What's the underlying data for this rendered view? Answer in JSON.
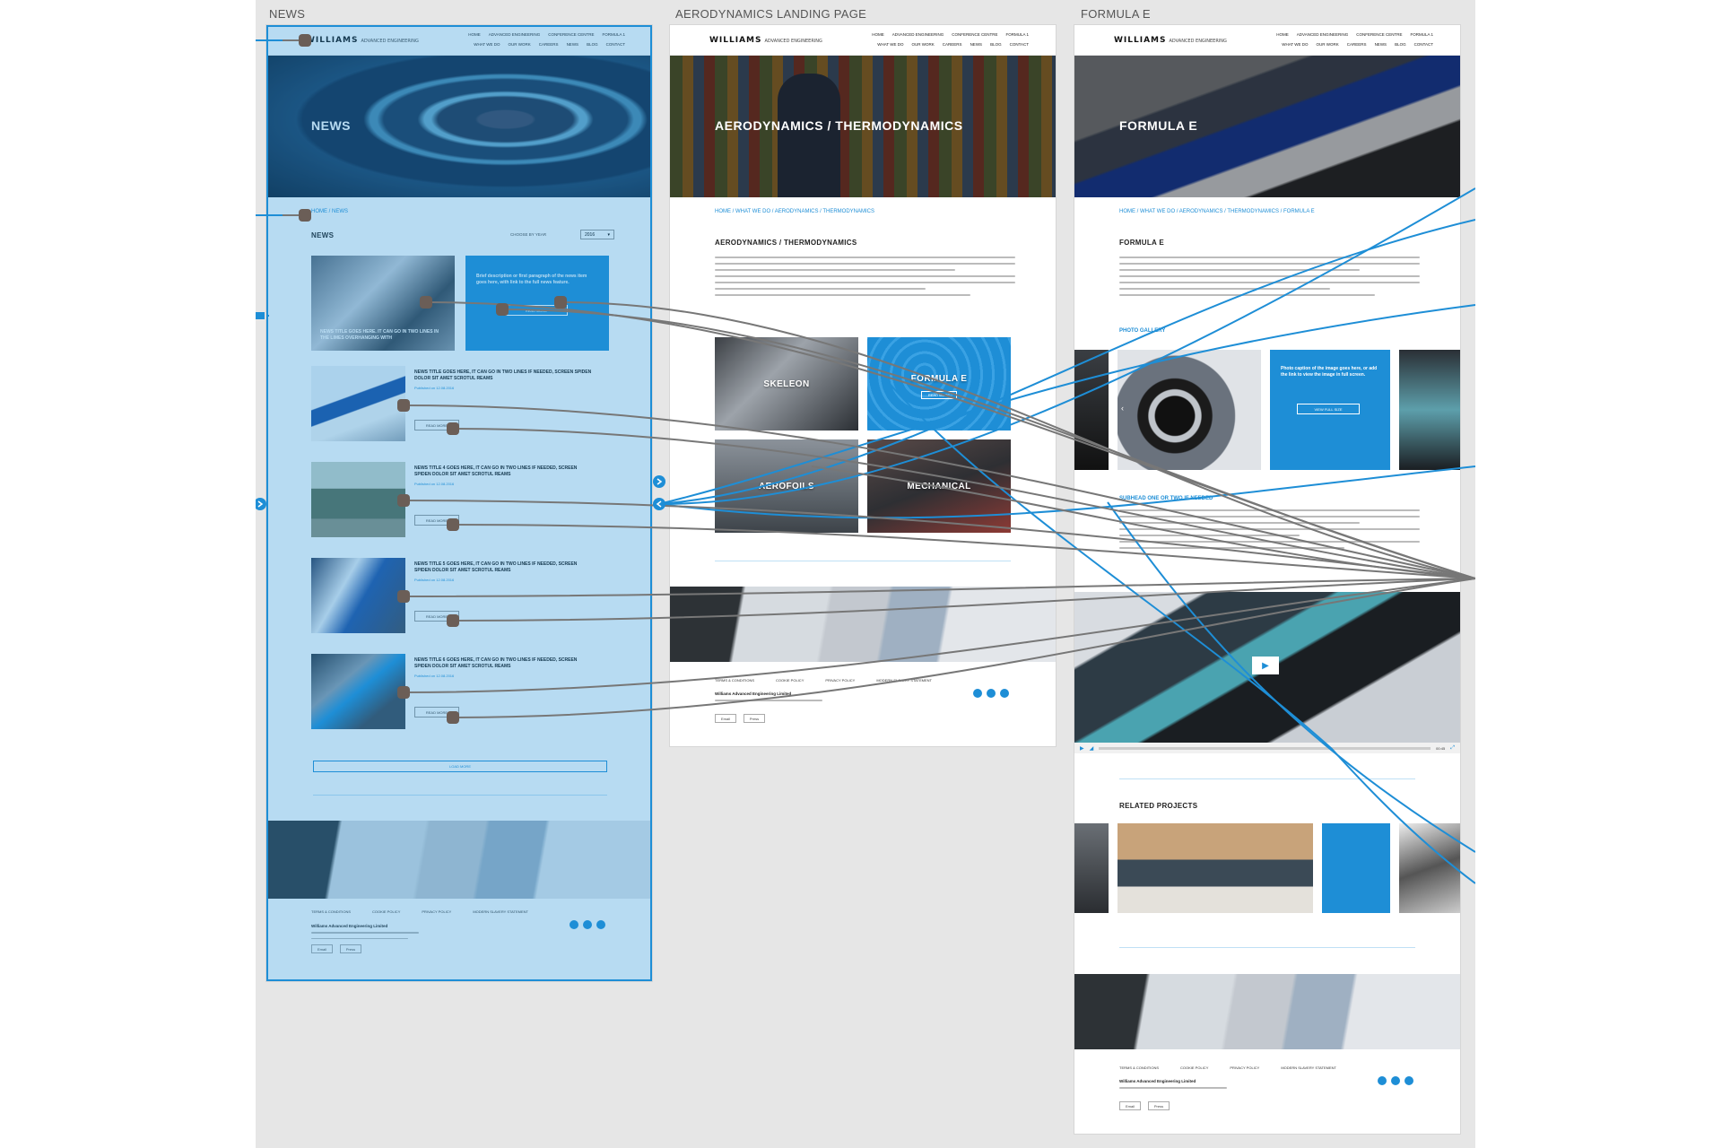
{
  "artboards": {
    "news": {
      "label": "NEWS",
      "brand": "WILLIAMS",
      "brand_sub": "ADVANCED ENGINEERING",
      "nav_top": [
        "Home",
        "Advanced Engineering",
        "Conference Centre",
        "Formula 1"
      ],
      "nav_bottom": [
        "What we do",
        "Our work",
        "Careers",
        "News",
        "Blog",
        "Contact"
      ],
      "hero_title": "NEWS",
      "breadcrumb": "HOME  /  NEWS",
      "section_title": "NEWS",
      "filter_label": "CHOOSE BY YEAR",
      "filter_value": "2016",
      "featured_caption": "NEWS TITLE GOES HERE. IT CAN GO IN TWO LINES IN THE LIMES OVERHANGING WITH",
      "featured_text": "Brief description or first paragraph of the news item goes here, with link to the full news feature.",
      "featured_button": "READ MORE",
      "news_items": [
        {
          "title": "NEWS TITLE GOES HERE, IT CAN GO IN TWO LINES IF NEEDED, SCREEN SPIDEN DOLOR SIT AMET SCROTUL REAMS",
          "date": "Published on 12.08.2016",
          "button": "READ MORE"
        },
        {
          "title": "NEWS TITLE 4 GOES HERE, IT CAN GO IN TWO LINES IF NEEDED, SCREEN SPIDEN DOLOR SIT AMET SCROTUL REAMS",
          "date": "Published on 12.08.2016",
          "button": "READ MORE"
        },
        {
          "title": "NEWS TITLE 5 GOES HERE, IT CAN GO IN TWO LINES IF NEEDED, SCREEN SPIDEN DOLOR SIT AMET SCROTUL REAMS",
          "date": "Published on 12.08.2016",
          "button": "READ MORE"
        },
        {
          "title": "NEWS TITLE 6 GOES HERE, IT CAN GO IN TWO LINES IF NEEDED, SCREEN SPIDEN DOLOR SIT AMET SCROTUL REAMS",
          "date": "Published on 12.08.2016",
          "button": "READ MORE"
        }
      ],
      "load_more": "LOAD MORE",
      "footer_links": [
        "Terms & conditions",
        "Cookie policy",
        "Privacy policy",
        "Modern slavery statement"
      ],
      "footer_company": "Williams Advanced Engineering Limited",
      "footer_btn1": "Email",
      "footer_btn2": "Press"
    },
    "aero": {
      "label": "AERODYNAMICS LANDING PAGE",
      "brand": "WILLIAMS",
      "brand_sub": "ADVANCED ENGINEERING",
      "nav_top": [
        "Home",
        "Advanced Engineering",
        "Conference Centre",
        "Formula 1"
      ],
      "nav_bottom": [
        "What we do",
        "Our work",
        "Careers",
        "News",
        "Blog",
        "Contact"
      ],
      "hero_title": "AERODYNAMICS / THERMODYNAMICS",
      "breadcrumb": "HOME  /  WHAT WE DO  /  AERODYNAMICS / THERMODYNAMICS",
      "section_title": "AERODYNAMICS / THERMODYNAMICS",
      "tiles": [
        "SKELEON",
        "FORMULA E",
        "AEROFOILS",
        "MECHANICAL"
      ],
      "tile_button": "READ MORE",
      "footer_links": [
        "Terms & conditions",
        "Cookie policy",
        "Privacy policy",
        "Modern slavery statement"
      ],
      "footer_company": "Williams Advanced Engineering Limited",
      "footer_btn1": "Email",
      "footer_btn2": "Press"
    },
    "fe": {
      "label": "FORMULA E",
      "brand": "WILLIAMS",
      "brand_sub": "ADVANCED ENGINEERING",
      "nav_top": [
        "Home",
        "Advanced Engineering",
        "Conference Centre",
        "Formula 1"
      ],
      "nav_bottom": [
        "What we do",
        "Our work",
        "Careers",
        "News",
        "Blog",
        "Contact"
      ],
      "hero_title": "FORMULA E",
      "breadcrumb": "HOME  /  WHAT WE DO  /  AERODYNAMICS / THERMODYNAMICS  /  FORMULA E",
      "section_title": "FORMULA E",
      "gallery_title": "PHOTO GALLERY",
      "gallery_caption": "Photo caption of the image goes here, or add the link to view the image in full screen.",
      "gallery_button": "VIEW FULL SIZE",
      "subhead": "SUBHEAD ONE OR TWO IF NEEDED",
      "video_time": "00:45",
      "related_title": "RELATED PROJECTS",
      "footer_links": [
        "Terms & conditions",
        "Cookie policy",
        "Privacy policy",
        "Modern slavery statement"
      ],
      "footer_company": "Williams Advanced Engineering Limited",
      "footer_btn1": "Email",
      "footer_btn2": "Press"
    }
  },
  "colors": {
    "accent": "#1e8ed6",
    "selection": "#a9d4f5",
    "canvas": "#e6e6e6",
    "connector": "#777777"
  }
}
